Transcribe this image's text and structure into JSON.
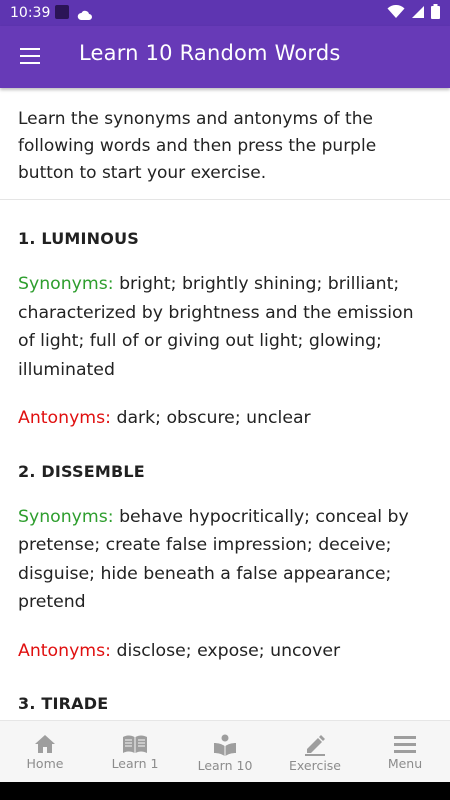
{
  "status_bar": {
    "time": "10:39",
    "icons": [
      "app-notification-icon",
      "cloud-icon",
      "wifi-icon",
      "signal-icon",
      "battery-icon"
    ]
  },
  "app_bar": {
    "title": "Learn 10 Random Words",
    "menu_icon": "hamburger-menu-icon"
  },
  "intro": "Learn the synonyms and antonyms of the following words and then press the purple button to start your exercise.",
  "labels": {
    "synonyms": "Synonyms:",
    "antonyms": "Antonyms:"
  },
  "words": [
    {
      "heading": "1. LUMINOUS",
      "synonyms": "bright; brightly shining; brilliant; characterized by brightness and the emission of light; full of or giving out light; glowing; illuminated",
      "antonyms": "dark; obscure; unclear"
    },
    {
      "heading": "2. DISSEMBLE",
      "synonyms": "behave hypocritically; conceal by pretense; create false impression; deceive; disguise; hide beneath a false appearance; pretend",
      "antonyms": "disclose; expose; uncover"
    },
    {
      "heading": "3. TIRADE"
    }
  ],
  "bottom_nav": [
    {
      "label": "Home",
      "icon": "home-icon"
    },
    {
      "label": "Learn 1",
      "icon": "book-icon"
    },
    {
      "label": "Learn 10",
      "icon": "reader-icon"
    },
    {
      "label": "Exercise",
      "icon": "pencil-icon"
    },
    {
      "label": "Menu",
      "icon": "menu-icon"
    }
  ],
  "colors": {
    "primary": "#673ab7",
    "status_bar": "#5e35b1",
    "synonyms": "#2e9e2e",
    "antonyms": "#e01010",
    "nav_label": "#8c8c8c"
  }
}
